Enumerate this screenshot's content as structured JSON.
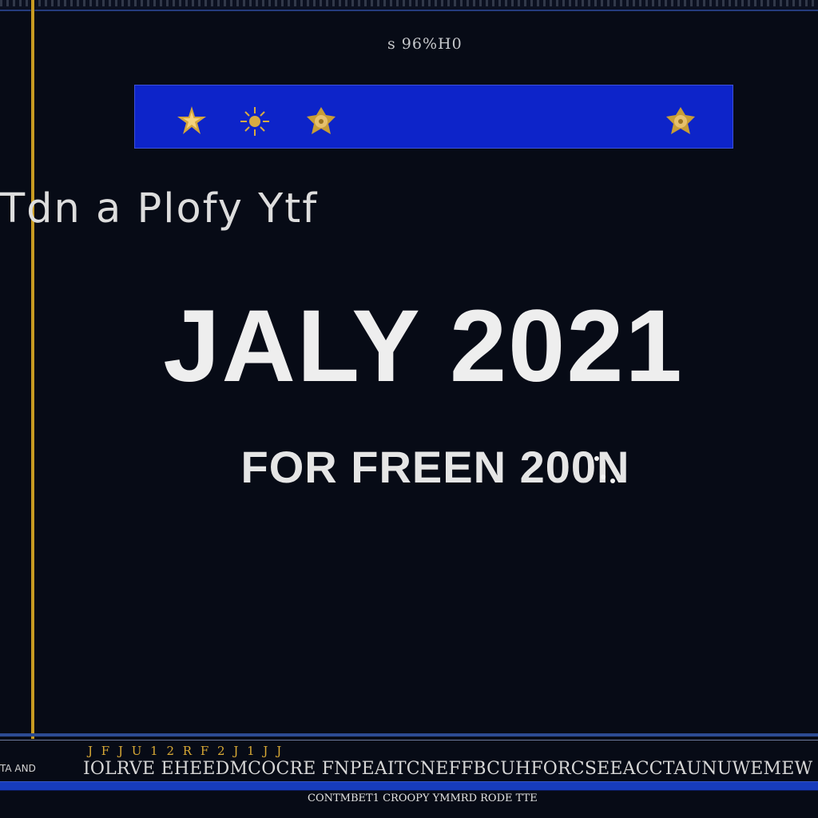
{
  "header": {
    "code": "s 96%H0"
  },
  "banner": {
    "background": "#0d24c9",
    "icons": [
      "star-icon",
      "sun-star-icon",
      "emblem-star-icon",
      "emblem-star-icon"
    ]
  },
  "content": {
    "subtitle": "Tdn a Plofy Ytf",
    "title": "JALY 2021",
    "secondary": "FOR FREEN 200N"
  },
  "footer": {
    "gold_line": "J F J U   1  2 R  F   2  J  1 J  J",
    "left_text": "TA   AND",
    "main_line": "IOLRVE EHEEDMCOCRE FNPEAITCNEFFBCUHFORCSEEACCTAUNUWEMEW   BCEEGIIE",
    "bottom_line": "CONTMBET1 CROOPY YMMRD   RODE TTE"
  },
  "colors": {
    "background": "#070b16",
    "accent_blue": "#0d24c9",
    "gold": "#c89b22"
  }
}
